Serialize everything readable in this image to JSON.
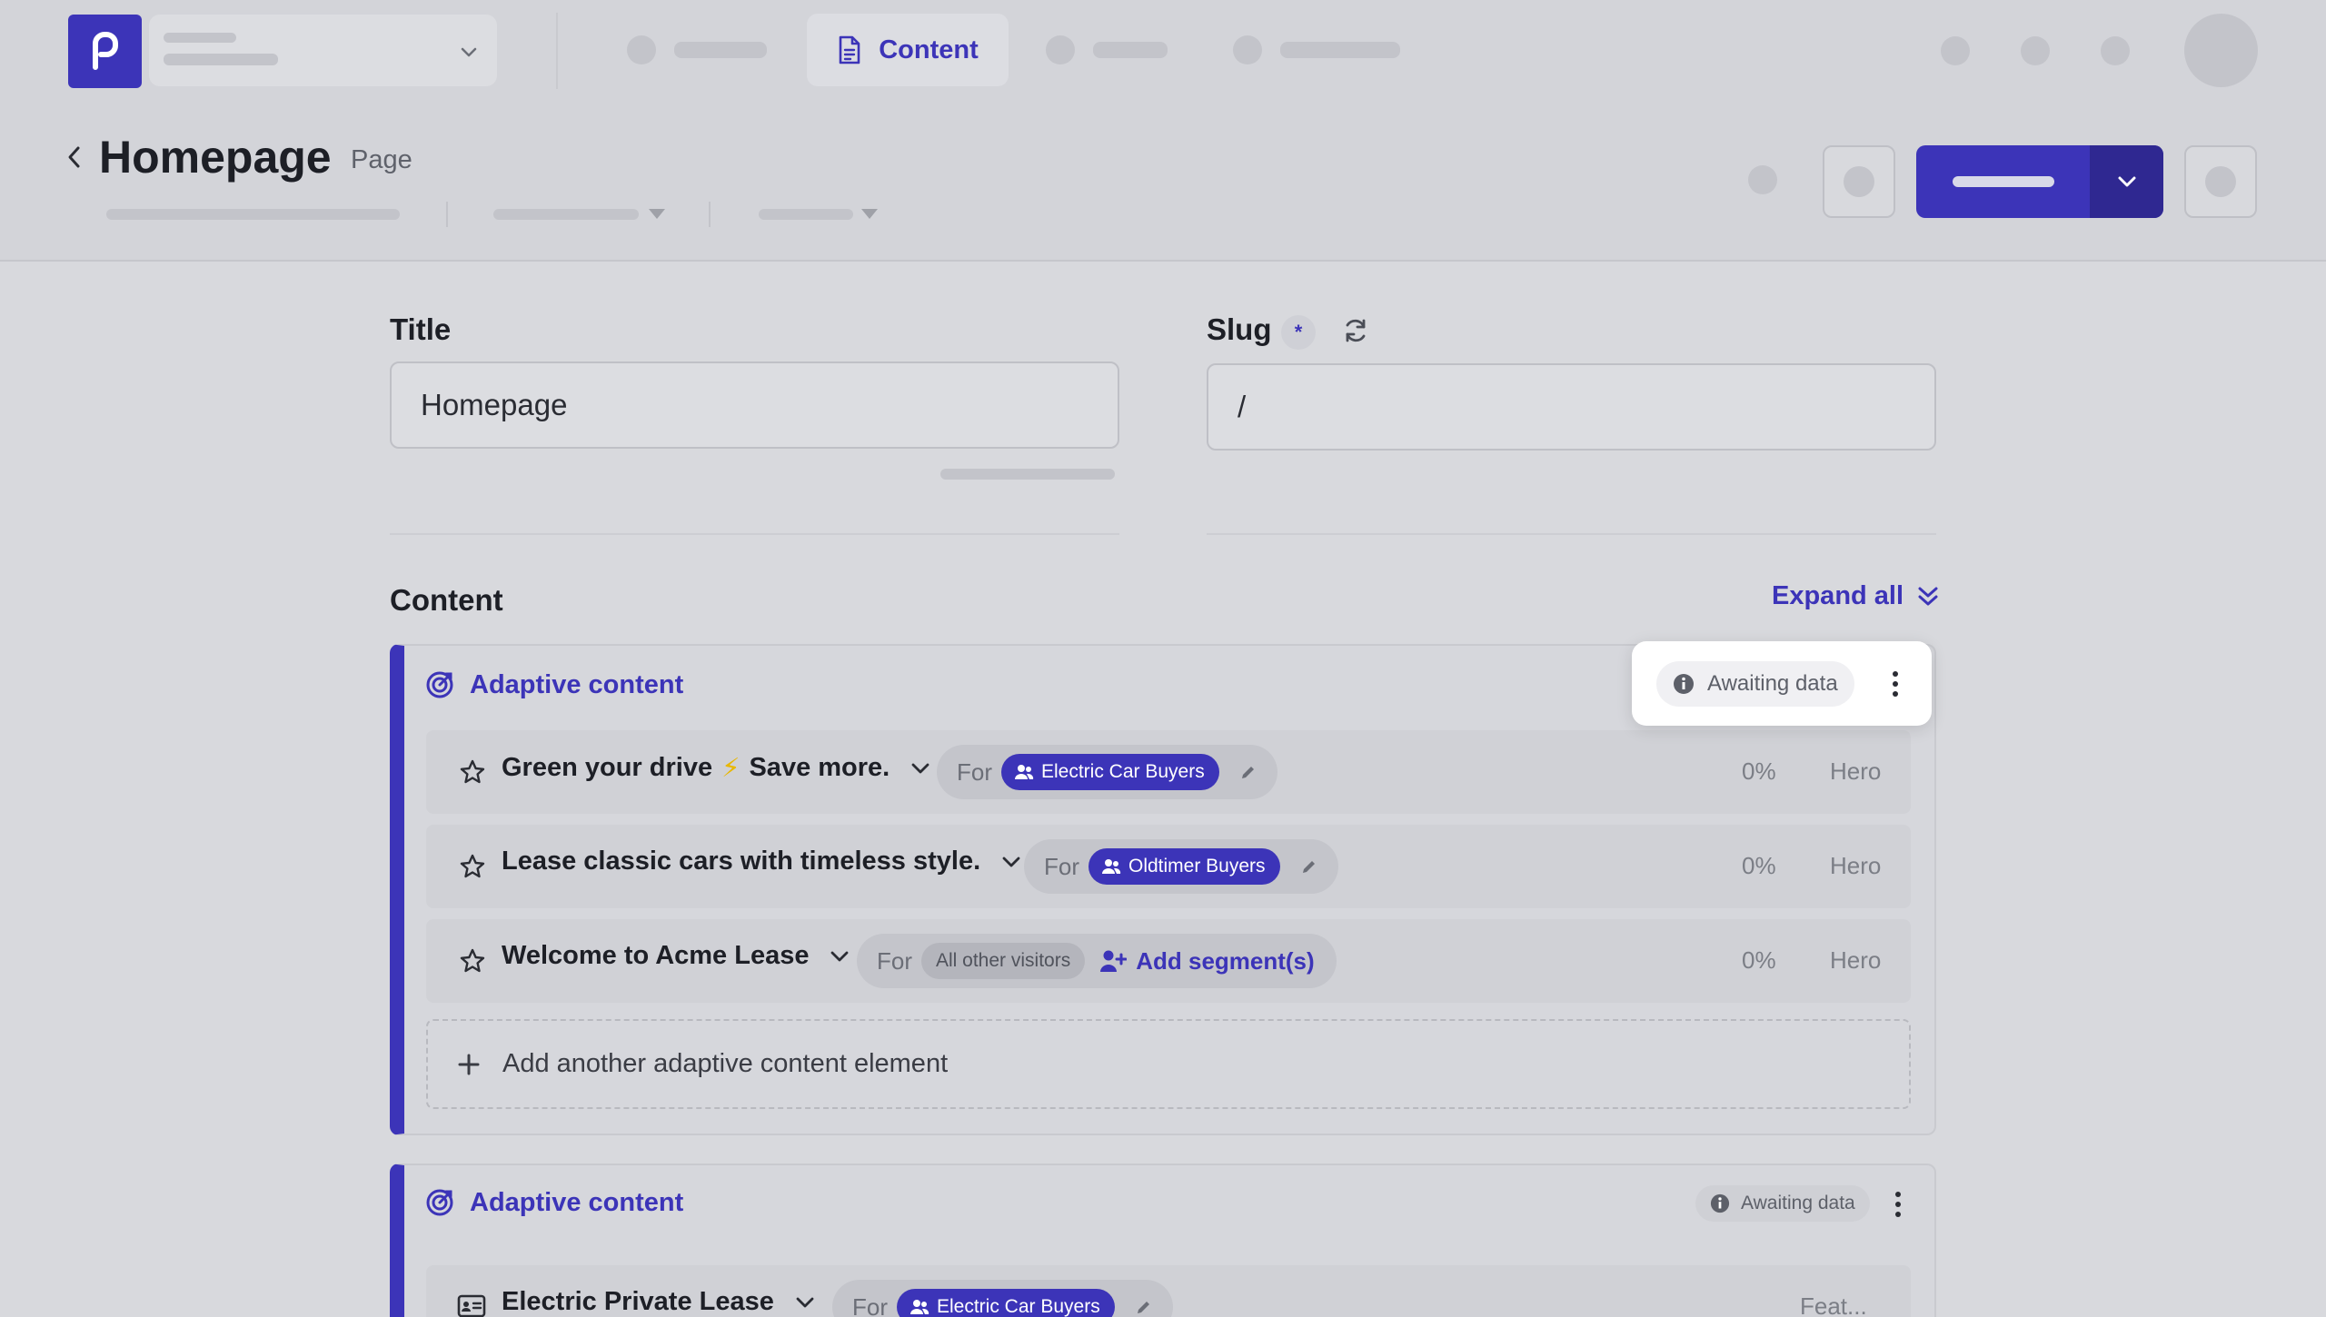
{
  "nav": {
    "active_tab": "Content"
  },
  "header": {
    "title": "Homepage",
    "type": "Page"
  },
  "form": {
    "title_label": "Title",
    "title_value": "Homepage",
    "slug_label": "Slug",
    "slug_required": "*",
    "slug_value": "/"
  },
  "content": {
    "section_title": "Content",
    "expand_all": "Expand all",
    "blocks": [
      {
        "title": "Adaptive content",
        "status": "Awaiting data",
        "variants": [
          {
            "title_part1": "Green your drive",
            "emoji": "⚡",
            "title_part2": "Save more.",
            "for_label": "For",
            "segment": "Electric Car Buyers",
            "percent": "0%",
            "slot": "Hero"
          },
          {
            "title": "Lease classic cars with timeless style.",
            "for_label": "For",
            "segment": "Oldtimer Buyers",
            "percent": "0%",
            "slot": "Hero"
          },
          {
            "title": "Welcome to Acme Lease",
            "for_label": "For",
            "segment": "All other visitors",
            "add_segment": "Add segment(s)",
            "percent": "0%",
            "slot": "Hero"
          }
        ],
        "add_another": "Add another adaptive content element"
      },
      {
        "title": "Adaptive content",
        "status": "Awaiting data",
        "variants": [
          {
            "title": "Electric Private Lease",
            "for_label": "For",
            "segment": "Electric Car Buyers",
            "slot": "Feat..."
          }
        ]
      }
    ]
  },
  "colors": {
    "accent": "#3c34b8",
    "background": "#d8d9dd"
  }
}
